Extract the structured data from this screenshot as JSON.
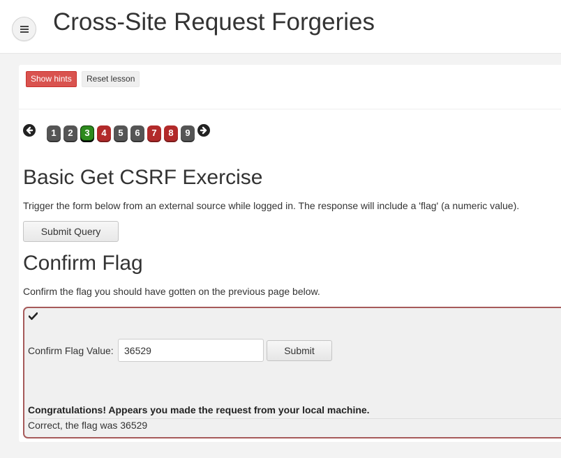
{
  "header": {
    "title": "Cross-Site Request Forgeries",
    "menu_icon": "hamburger-menu-icon"
  },
  "lesson_controls": {
    "show_hints": "Show hints",
    "reset_lesson": "Reset lesson"
  },
  "pagination": {
    "prev_icon": "arrow-left-icon",
    "next_icon": "arrow-right-icon",
    "pages": [
      {
        "label": "1",
        "status": "grey"
      },
      {
        "label": "2",
        "status": "grey"
      },
      {
        "label": "3",
        "status": "green"
      },
      {
        "label": "4",
        "status": "red"
      },
      {
        "label": "5",
        "status": "grey"
      },
      {
        "label": "6",
        "status": "grey"
      },
      {
        "label": "7",
        "status": "red"
      },
      {
        "label": "8",
        "status": "red"
      },
      {
        "label": "9",
        "status": "grey"
      }
    ],
    "colors": {
      "grey": "#555555",
      "red": "#b22a2a",
      "green": "#2d8a1e"
    }
  },
  "exercise": {
    "heading": "Basic Get CSRF Exercise",
    "instruction": "Trigger the form below from an external source while logged in. The response will include a 'flag' (a numeric value).",
    "submit_label": "Submit Query"
  },
  "confirm": {
    "heading": "Confirm Flag",
    "instruction": "Confirm the flag you should have gotten on the previous page below.",
    "check_icon": "checkmark-icon",
    "field_label": "Confirm Flag Value:",
    "field_value": "36529",
    "submit_label": "Submit",
    "congrats": "Congratulations! Appears you made the request from your local machine.",
    "result": "Correct, the flag was 36529",
    "border_color": "#a65a5a"
  },
  "colors": {
    "hint_button": "#d9534f",
    "page_background": "#f3f3f3"
  }
}
